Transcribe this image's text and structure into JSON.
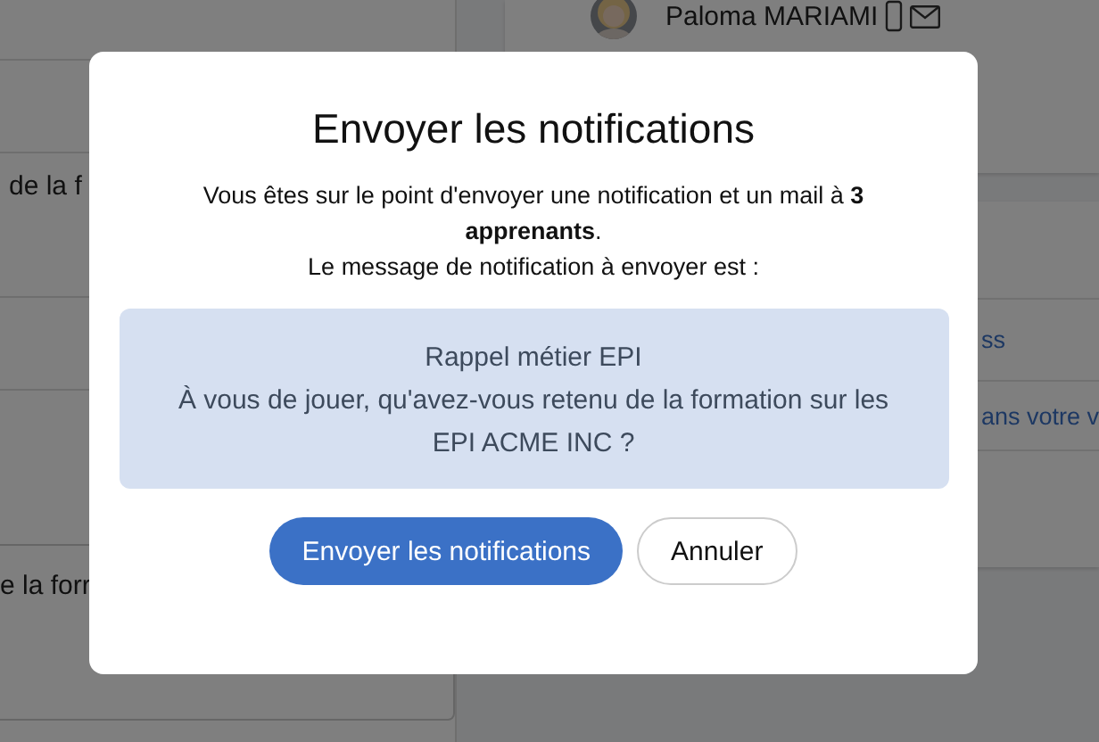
{
  "background": {
    "left_fragments": [
      "de la f",
      "e la forr"
    ],
    "user": {
      "name": "Paloma MARIAMI"
    },
    "right_fragments": [
      "ss",
      "ans votre v"
    ]
  },
  "dialog": {
    "title": "Envoyer les notifications",
    "message": "Vous êtes sur le point d'envoyer une notification et un mail à **3 apprenants**.",
    "message_line2": "Le message de notification à envoyer est :",
    "notification": {
      "title": "Rappel métier EPI",
      "body": "À vous de jouer, qu'avez-vous retenu de la formation sur les EPI ACME INC ?"
    },
    "buttons": [
      {
        "label": "Envoyer les notifications",
        "kind": "primary"
      },
      {
        "label": "Annuler",
        "kind": "secondary"
      }
    ]
  }
}
